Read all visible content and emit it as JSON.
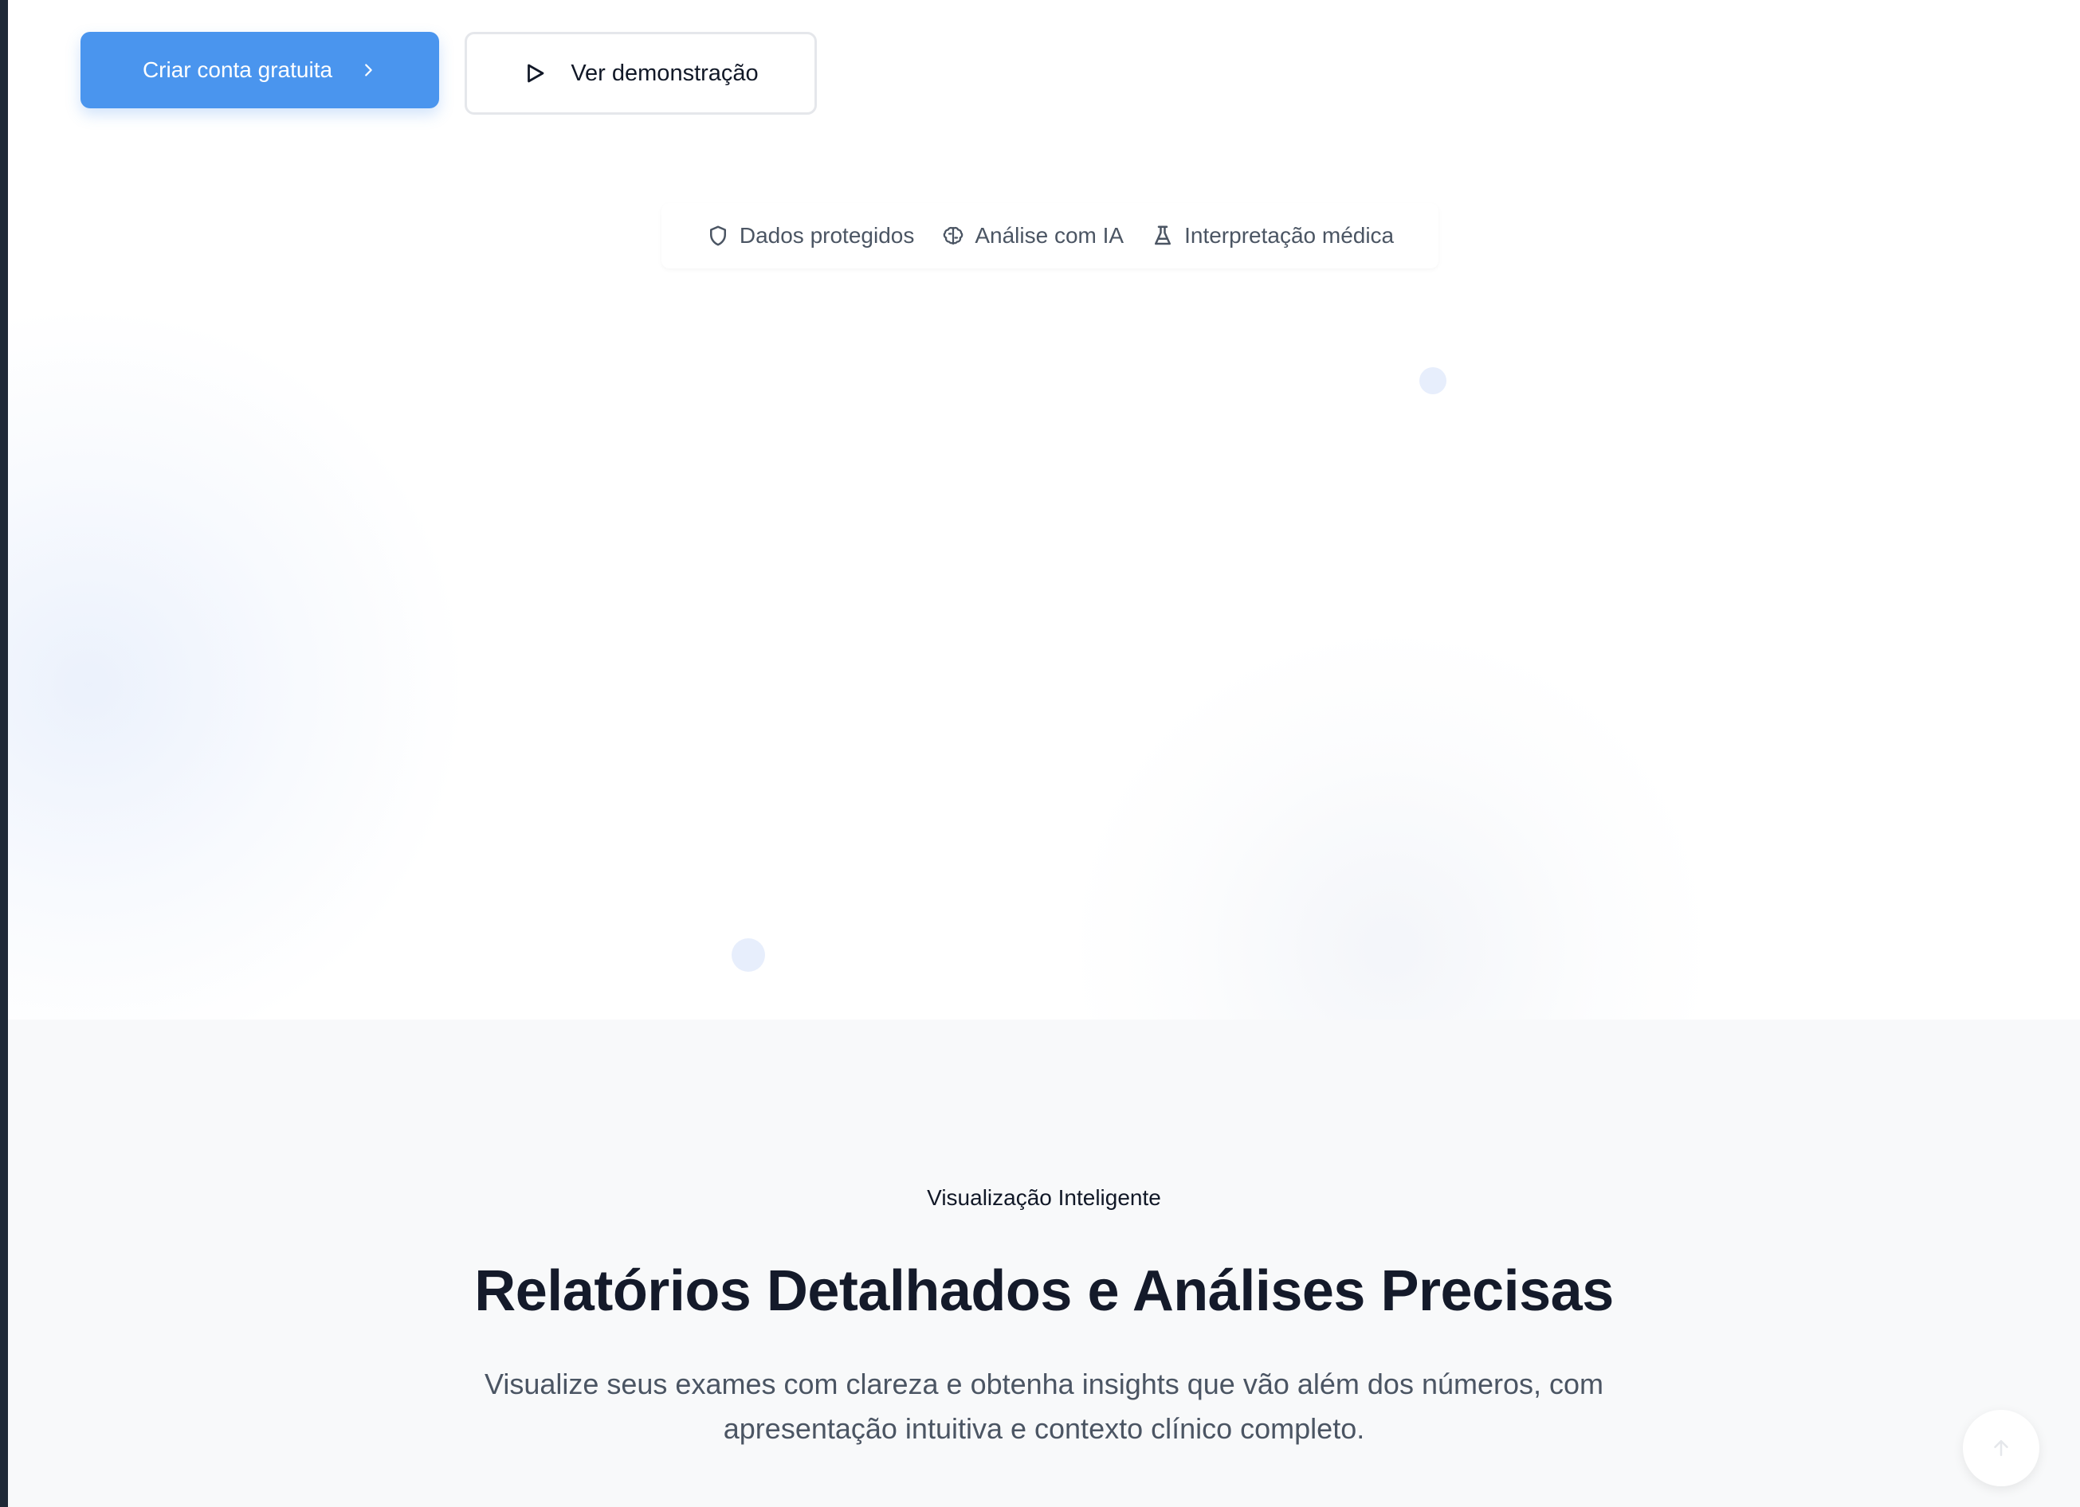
{
  "hero": {
    "primary_button": {
      "label": "Criar conta gratuita",
      "icon": "chevron-right-icon"
    },
    "secondary_button": {
      "label": "Ver demonstração",
      "icon": "play-icon"
    },
    "badges": [
      {
        "label": "Dados protegidos",
        "icon": "shield-icon"
      },
      {
        "label": "Análise com IA",
        "icon": "brain-icon"
      },
      {
        "label": "Interpretação médica",
        "icon": "flask-icon"
      }
    ]
  },
  "features": {
    "eyebrow": "Visualização Inteligente",
    "title": "Relatórios Detalhados e Análises Precisas",
    "description": "Visualize seus exames com clareza e obtenha insights que vão além dos números, com apresentação intuitiva e contexto clínico completo."
  },
  "scroll_top": {
    "icon": "arrow-up-icon"
  },
  "colors": {
    "primary": "#4a95ee",
    "heading": "#141a2a",
    "muted_text": "#4b5563",
    "section_bg": "#f8f9fa"
  }
}
